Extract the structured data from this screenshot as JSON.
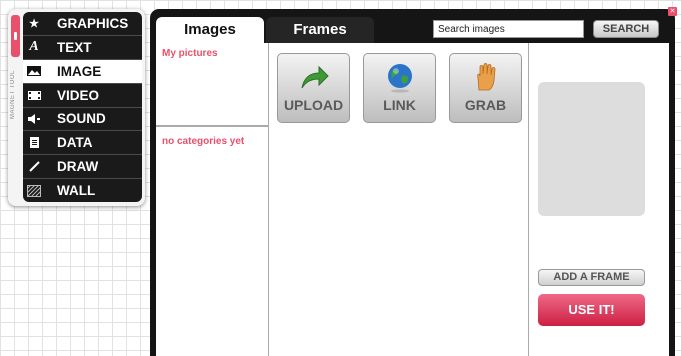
{
  "palette": {
    "label": "MAGNET TOOL",
    "tools": [
      {
        "label": "GRAPHICS",
        "icon": "star-icon",
        "active": false
      },
      {
        "label": "TEXT",
        "icon": "text-a-icon",
        "active": false
      },
      {
        "label": "IMAGE",
        "icon": "image-icon",
        "active": true
      },
      {
        "label": "VIDEO",
        "icon": "video-icon",
        "active": false
      },
      {
        "label": "SOUND",
        "icon": "speaker-icon",
        "active": false
      },
      {
        "label": "DATA",
        "icon": "document-icon",
        "active": false
      },
      {
        "label": "DRAW",
        "icon": "pencil-icon",
        "active": false
      },
      {
        "label": "WALL",
        "icon": "wall-pattern-icon",
        "active": false
      }
    ]
  },
  "header": {
    "tabs": [
      {
        "label": "Images",
        "active": true
      },
      {
        "label": "Frames",
        "active": false
      }
    ],
    "search": {
      "value": "",
      "placeholder": "Search images",
      "button_label": "SEARCH"
    }
  },
  "categories": {
    "my_pictures": "My pictures",
    "empty_text": "no categories yet"
  },
  "actions": [
    {
      "label": "UPLOAD",
      "icon": "upload-arrow-icon"
    },
    {
      "label": "LINK",
      "icon": "globe-icon"
    },
    {
      "label": "GRAB",
      "icon": "hand-icon"
    }
  ],
  "preview": {
    "add_frame_label": "ADD A FRAME",
    "use_label": "USE IT!"
  },
  "colors": {
    "accent": "#e8506c",
    "panel": "#151515"
  }
}
